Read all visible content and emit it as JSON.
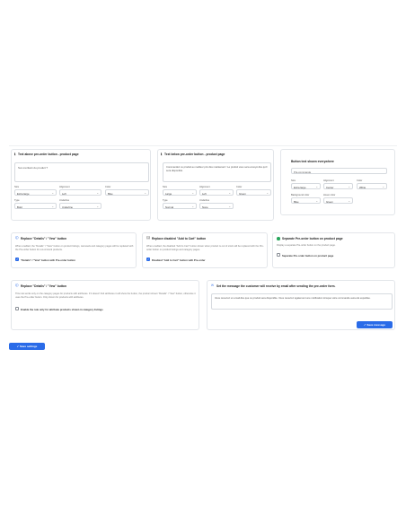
{
  "text_above": {
    "title": "Text above pre-order button - product page",
    "textarea": "Sur-méritant du produit ?",
    "size_label": "Size",
    "size_value": "Extra large",
    "alignment_label": "Alignment",
    "alignment_value": "Left",
    "color_label": "Color",
    "color_value": "Blue",
    "type_label": "Type",
    "type_value": "Bold",
    "underline_label": "Underline",
    "underline_value": "Underline"
  },
  "text_below": {
    "title": "Text below pre-order button - product page",
    "textarea": "Commandez ce produit au meilleur prix dès maintenant ! Le produit vous sera envoyé dès qu'il sera disponible.",
    "size_label": "Size",
    "size_value": "Large",
    "alignment_label": "Alignment",
    "alignment_value": "Left",
    "color_label": "Color",
    "color_value": "Green",
    "type_label": "Type",
    "type_value": "Normal",
    "underline_label": "Underline",
    "underline_value": "None"
  },
  "button_text": {
    "title": "Button text shown everywhere",
    "input": "Pré-commande",
    "size_label": "Size",
    "size_value": "Extra large",
    "alignment_label": "Alignment",
    "alignment_value": "Center",
    "color_label": "Color",
    "color_value": "White",
    "bg_label": "Background color",
    "bg_value": "Blue",
    "hover_label": "Hover color",
    "hover_value": "Green"
  },
  "replace_details": {
    "title": "Replace \"Details\" / \"Vew\" button",
    "desc": "When enabled, the \"Details\" / \"View\" button on product listings, carousels and category pages will be replaced with the Pre-order button for out-of-stock products.",
    "checkbox": "\"Details\" / \"Vew\" button with Pre-order button"
  },
  "replace_disabled": {
    "title": "Replace disabled \"Add to Cart\" button",
    "desc": "When enabled, the disabled \"Add to Cart\" button shown when product is out of stock will be replaced with the Pre-order button on product listings and category pages.",
    "checkbox": "Disabled \"Add to Cart\" button with Pre-order"
  },
  "separate": {
    "title": "Separate Pre-order button on product page",
    "desc": "Display a separate Pre-order button on the product page.",
    "checkbox": "Separate Pre-order button on product page"
  },
  "replace_details_2": {
    "title": "Replace \"Details\" / \"Vew\" button",
    "desc": "This rule works only on the category pages for products with attributes. If it doesn't find attributes it will show the button, the product shown \"Details\" / \"Vew\" button, otherwise it uses the Pre-order button. Only shown for products with attributes.",
    "checkbox": "Enable the rule only for attribute products shown in category listings"
  },
  "email_message": {
    "title": "Set the message the customer will receive by email after sending the pre-order form.",
    "textarea": "Vous recevrez un email dès que ce produit sera disponible. Vous recevrez également une notification lorsque votre commande aura été expédiée.",
    "save_label": "✓ Save message"
  },
  "save_settings_label": "✓ Save settings",
  "icons": {
    "text_icon": "text-icon",
    "info_icon": "info-icon",
    "image_icon": "image-icon",
    "check_icon": "check-icon",
    "mail_icon": "mail-icon"
  },
  "colors": {
    "accent": "#2a6be8",
    "success": "#26a65b",
    "border": "#e3e6ea"
  }
}
